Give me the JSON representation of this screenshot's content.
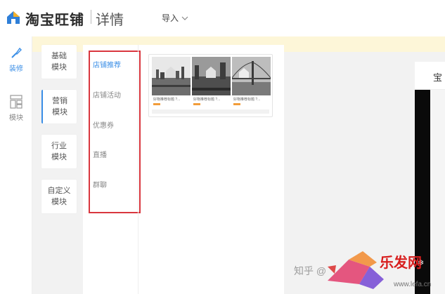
{
  "header": {
    "brand": "淘宝旺铺",
    "subtitle": "详情",
    "import_label": "导入"
  },
  "rail": {
    "items": [
      {
        "label": "装修",
        "icon": "brush-icon",
        "active": true
      },
      {
        "label": "模块",
        "icon": "module-icon",
        "active": false
      }
    ]
  },
  "categories": [
    {
      "label_1": "基础",
      "label_2": "模块",
      "active": false
    },
    {
      "label_1": "营销",
      "label_2": "模块",
      "active": true
    },
    {
      "label_1": "行业",
      "label_2": "模块",
      "active": false
    },
    {
      "label_1": "自定义",
      "label_2": "模块",
      "active": false
    }
  ],
  "sub_items": [
    {
      "label": "店铺推荐",
      "active": true
    },
    {
      "label": "店铺活动",
      "active": false
    },
    {
      "label": "优惠券",
      "active": false
    },
    {
      "label": "直播",
      "active": false
    },
    {
      "label": "群聊",
      "active": false
    }
  ],
  "card": {
    "thumbs": [
      {
        "caption": "好物推荐标题 ?..."
      },
      {
        "caption": "好物推荐标题 ?..."
      },
      {
        "caption": "好物推荐标题 ?..."
      }
    ]
  },
  "preview": {
    "header_char": "宝"
  },
  "watermark": {
    "left_text": "知乎 @",
    "site_name": "乐发网",
    "site_url": "www.lefa.cn"
  },
  "colors": {
    "accent": "#3a8ee6",
    "highlight_border": "#d9363e",
    "notice_bar": "#fdf6d8",
    "price": "#f29d3a"
  }
}
